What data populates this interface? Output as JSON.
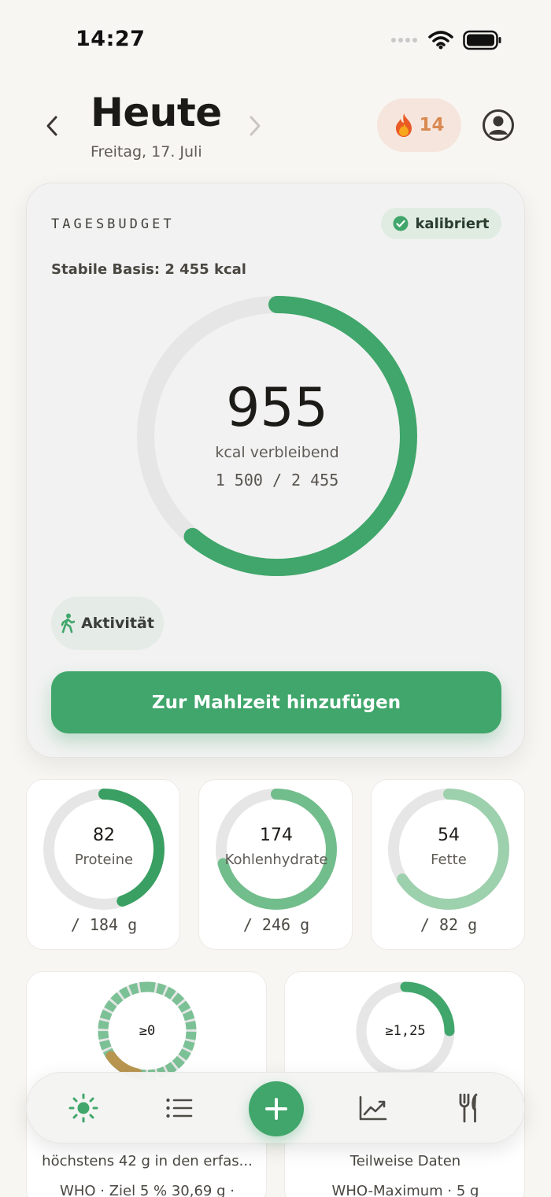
{
  "status_bar": {
    "time": "14:27"
  },
  "header": {
    "title": "Heute",
    "date": "Freitag, 17. Juli",
    "streak_count": "14"
  },
  "budget": {
    "label": "TAGESBUDGET",
    "badge": "kalibriert",
    "basis": "Stabile Basis: 2 455 kcal",
    "remaining": "955",
    "remaining_label": "kcal verbleibend",
    "ratio": "1 500 / 2 455",
    "consumed_kcal": 1500,
    "target_kcal": 2455,
    "activity_label": "Aktivität",
    "add_button": "Zur Mahlzeit hinzufügen"
  },
  "macros": [
    {
      "value": "82",
      "name": "Proteine",
      "target": "/ 184 g",
      "current": 82,
      "max": 184,
      "color": "#3a9f62"
    },
    {
      "value": "174",
      "name": "Kohlenhydrate",
      "target": "/ 246 g",
      "current": 174,
      "max": 246,
      "color": "#72bd8c"
    },
    {
      "value": "54",
      "name": "Fette",
      "target": "/ 82 g",
      "current": 54,
      "max": 82,
      "color": "#9dd0ac"
    }
  ],
  "nutrients": [
    {
      "center": "≥0",
      "desc": "höchstens 42 g in den erfas...",
      "ref": "WHO · Ziel 5 % 30,69 g ·"
    },
    {
      "center": "≥1,25",
      "desc": "Teilweise Daten",
      "ref": "WHO-Maximum · 5 g"
    }
  ],
  "colors": {
    "accent": "#40a66b",
    "streak": "#d98a52",
    "track": "#e6e6e6",
    "warning": "#b99650"
  },
  "tabs": [
    "sun-icon",
    "list-icon",
    "plus-icon",
    "chart-icon",
    "cutlery-icon"
  ]
}
